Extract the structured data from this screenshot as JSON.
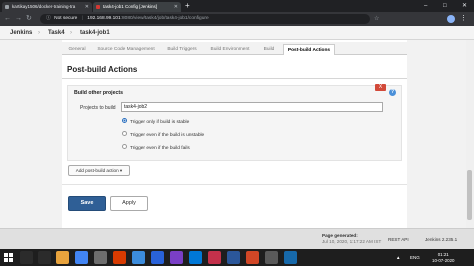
{
  "browser": {
    "tabs": [
      {
        "title": "kartikay1506/docker-training-tra"
      },
      {
        "title": "task4-job1 Config [Jenkins]"
      }
    ],
    "new_tab": "+",
    "window_controls": {
      "minimize": "–",
      "maximize": "□",
      "close": "✕"
    },
    "address": {
      "security": "Not secure",
      "host": "192.168.99.101",
      "path": ":8080/view/task4/job/task4-job1/configure"
    }
  },
  "breadcrumb": {
    "items": [
      "Jenkins",
      "Task4",
      "task4-job1"
    ],
    "separator": "›"
  },
  "config_tabs": [
    "General",
    "Source Code Management",
    "Build Triggers",
    "Build Environment",
    "Build",
    "Post-build Actions"
  ],
  "active_tab": "Post-build Actions",
  "section": {
    "title": "Post-build Actions",
    "action": {
      "title": "Build other projects",
      "remove_label": "X",
      "help_label": "?",
      "projects_label": "Projects to build",
      "projects_value": "task4-job2",
      "radios": [
        {
          "label": "Trigger only if build is stable",
          "checked": true
        },
        {
          "label": "Trigger even if the build is unstable",
          "checked": false
        },
        {
          "label": "Trigger even if the build fails",
          "checked": false
        }
      ]
    },
    "add_button": "Add post-build action ▾"
  },
  "buttons": {
    "save": "Save",
    "apply": "Apply"
  },
  "footer": {
    "generated_label": "Page generated:",
    "generated_time": "Jul 10, 2020, 1:17:22 AM IST",
    "rest_api": "REST API",
    "version": "Jenkins 2.235.1"
  },
  "taskbar": {
    "time": "01:21",
    "date": "10-07-2020",
    "lang": "ENG"
  },
  "colors": {
    "save_button": "#2f5f96",
    "remove_button": "#d24939",
    "browser_chrome": "#202124"
  }
}
